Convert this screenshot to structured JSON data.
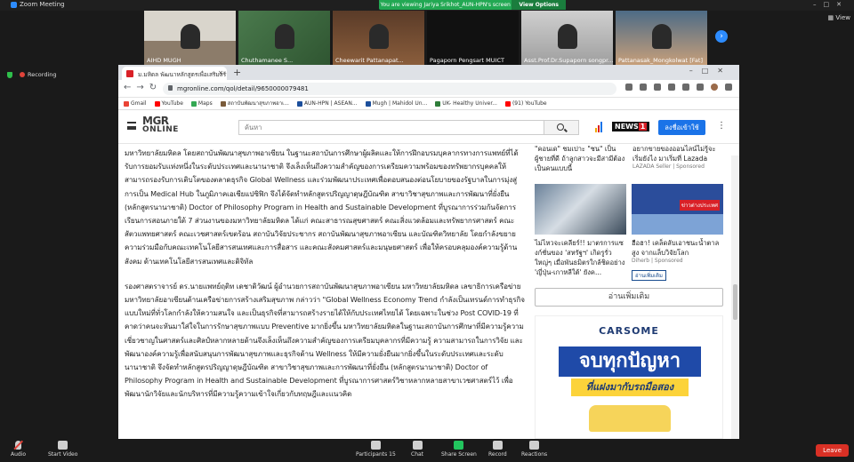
{
  "zoom": {
    "title": "Zoom Meeting",
    "share_banner": "You are viewing Jariya Srikhot_AUN-HPN's screen",
    "view_options": "View Options",
    "view_label": "View",
    "recording_label": "Recording",
    "participants": [
      {
        "name": "AIHD MUGH"
      },
      {
        "name": "Chuthamanee S..."
      },
      {
        "name": "Cheewarit Pattanapat..."
      },
      {
        "name": "Pagaporn Pengsart MUICT"
      },
      {
        "name": "Asst.Prof.Dr.Supaporn songpr..."
      },
      {
        "name": "Pattanasak_Mongkolwat [Fat]"
      }
    ],
    "bottom": {
      "audio": "Audio",
      "start_video": "Start Video",
      "participants": "Participants",
      "participants_count": "15",
      "chat": "Chat",
      "share_screen": "Share Screen",
      "record": "Record",
      "reactions": "Reactions",
      "leave": "Leave"
    }
  },
  "browser": {
    "tab_title": "ม.มหิดล พัฒนาหลักสูตรเพื่อเสริมสร้าง...",
    "url": "mgronline.com/qol/detail/9650000079481",
    "bookmarks": [
      "Gmail",
      "YouTube",
      "Maps",
      "สถาบันพัฒนาสุขภาพอาเ...",
      "AUN-HPN | ASEAN...",
      "Mugh | Mahidol Un...",
      "UK- Healthy Univer...",
      "(91) YouTube"
    ]
  },
  "site": {
    "logo_main": "MGR",
    "logo_sub": "ONLINE",
    "search_placeholder": "ค้นหา",
    "news1": "NEWS",
    "news1_num": "1",
    "register": "ลงชื่อเข้าใช้"
  },
  "article": {
    "p1": "มหาวิทยาลัยมหิดล โดยสถาบันพัฒนาสุขภาพอาเซียน ในฐานะสถาบันการศึกษาผู้ผลิตและให้การฝึกอบรมบุคลากรทางการแพทย์ที่ได้รับการยอมรับแห่งหนึ่งในระดับประเทศและนานาชาติ จึงเล็งเห็นถึงความสำคัญของการเตรียมความพร้อมของทรัพยากรบุคคลให้สามารถรองรับการเติบโตของตลาดธุรกิจ Global Wellness และร่วมพัฒนาประเทศเพื่อตอบสนองต่อนโยบายของรัฐบาลในการมุ่งสู่การเป็น Medical Hub ในภูมิภาคเอเชียแปซิฟิก จึงได้จัดทำหลักสูตรปริญญาดุษฎีบัณฑิต สาขาวิชาสุขภาพและการพัฒนาที่ยั่งยืน (หลักสูตรนานาชาติ) Doctor of Philosophy Program in Health and Sustainable Development ที่บูรณาการร่วมกันจัดการเรียนการสอนภายใต้ 7 ส่วนงานของมหาวิทยาลัยมหิดล ได้แก่ คณะสาธารณสุขศาสตร์ คณะสิ่งแวดล้อมและทรัพยากรศาสตร์ คณะสัตวแพทยศาสตร์ คณะเวชศาสตร์เขตร้อน สถาบันวิจัยประชากร สถาบันพัฒนาสุขภาพอาเซียน และบัณฑิตวิทยาลัย โดยกำลังขยายความร่วมมือกับคณะเทคโนโลยีสารสนเทศและการสื่อสาร และคณะสังคมศาสตร์และมนุษยศาสตร์ เพื่อให้ครอบคลุมองค์ความรู้ด้านสังคม ด้านเทคโนโลยีสารสนเทศและดิจิทัล",
    "p2": "รองศาสตราจารย์ ดร.นายแพทย์ฤติท เดชาดิวัฒน์ ผู้อำนวยการสถาบันพัฒนาสุขภาพอาเซียน มหาวิทยาลัยมหิดล เลขาธิการเครือข่ายมหาวิทยาลัยอาเซียนด้านเครือข่ายการสร้างเสริมสุขภาพ กล่าวว่า \"Global Wellness Economy Trend กำลังเป็นเทรนด์การทำธุรกิจแบบใหม่ที่ทั่วโลกกำลังให้ความสนใจ และเป็นธุรกิจที่สามารถสร้างรายได้ให้กับประเทศไทยได้ โดยเฉพาะในช่วง Post COVID-19 ที่คาดว่าคนจะหันมาใส่ใจในการรักษาสุขภาพแบบ Preventive มากยิ่งขึ้น มหาวิทยาลัยมหิดลในฐานะสถาบันการศึกษาที่มีความรู้ความเชี่ยวชาญในศาสตร์และศิลป์หลากหลายด้านจึงเล็งเห็นถึงความสำคัญของการเตรียมบุคลากรที่มีความรู้ ความสามารถในการวิจัย และพัฒนาองค์ความรู้เพื่อสนับสนุนการพัฒนาสุขภาพและธุรกิจด้าน Wellness ให้มีความยั่งยืนมากยิ่งขึ้นในระดับประเทศและระดับนานาชาติ จึงจัดทำหลักสูตรปริญญาดุษฎีบัณฑิต สาขาวิชาสุขภาพและการพัฒนาที่ยั่งยืน (หลักสูตรนานาชาติ) Doctor of Philosophy Program in Health and Sustainable Development ที่บูรณาการศาสตร์วิชาหลากหลายสาขาเวชศาสตร์ไว้ เพื่อพัฒนานักวิจัยและนักบริหารที่มีความรู้ความเข้าใจเกี่ยวกับทฤษฎีและแนวคิด"
  },
  "sidebar": {
    "top_left": "\"คอนเด\" ชมเปาะ \"ชน\" เป็นผู้ชายที่ดี ถ้าลูกสาวจะมีสามีต้องเป็นคนแบบนี้",
    "top_right": "อยากขายของออนไลน์ไม่รู้จะเริ่มยังไง มาเริ่มที่ Lazada",
    "top_right_sponsor": "LAZADA Seller | Sponsored",
    "card1": "ไม่ไหวจะเคลียร์!! มาตรการแซงก์ชั่นของ 'สหรัฐฯ' เกิดรูรั่วใหญ่ๆ เมื่อพันธมิตรใกล้ชิดอย่าง 'ญี่ปุ่น-เกาหลีใต้' ยังค...",
    "card2": "ฮือฮา! เคล็ดลับเอาชนะน้ำตาลสูง จากแล็บวิจัยโลก",
    "card2_sponsor": "Diherb | Sponsored",
    "card2_readmore": "อ่านเพิ่มเติม",
    "readmore": "อ่านเพิ่มเติม",
    "ad_brand": "CARSOME",
    "ad_main": "จบทุกปัญหา",
    "ad_sub": "ที่แฝงมากับรถมือสอง"
  }
}
